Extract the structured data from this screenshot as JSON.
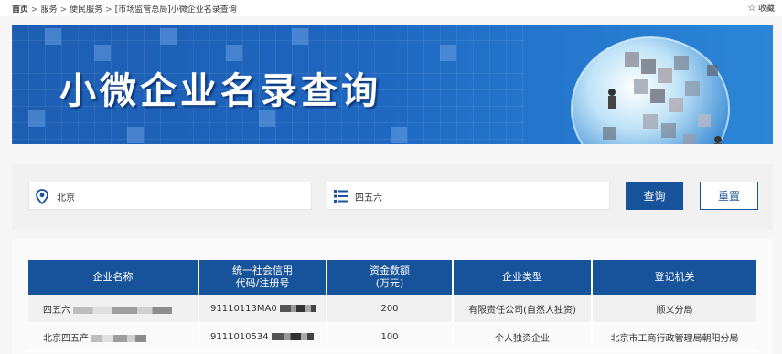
{
  "breadcrumb": {
    "items": [
      "首页",
      "服务",
      "便民服务",
      "[市场监管总局]小微企业名录查询"
    ],
    "separator": ">"
  },
  "favorite": {
    "icon": "star-outline-icon",
    "label": "收藏"
  },
  "banner": {
    "title": "小微企业名录查询"
  },
  "search": {
    "region": {
      "icon": "location-pin-icon",
      "value": "北京"
    },
    "keyword": {
      "icon": "list-icon",
      "value": "四五六"
    },
    "query_label": "查询",
    "reset_label": "重置"
  },
  "table": {
    "headers": [
      {
        "line1": "企业名称",
        "line2": ""
      },
      {
        "line1": "统一社会信用",
        "line2": "代码/注册号"
      },
      {
        "line1": "资金数额",
        "line2": "(万元)"
      },
      {
        "line1": "企业类型",
        "line2": ""
      },
      {
        "line1": "登记机关",
        "line2": ""
      }
    ],
    "rows": [
      {
        "name": "四五六",
        "code": "91110113MA0",
        "capital": "200",
        "type": "有限责任公司(自然人独资)",
        "authority": "顺义分局"
      },
      {
        "name": "北京四五产",
        "code": "9111010534",
        "capital": "100",
        "type": "个人独资企业",
        "authority": "北京市工商行政管理局朝阳分局"
      }
    ]
  },
  "colors": {
    "primary": "#17539a",
    "banner": "#1f66bf"
  }
}
